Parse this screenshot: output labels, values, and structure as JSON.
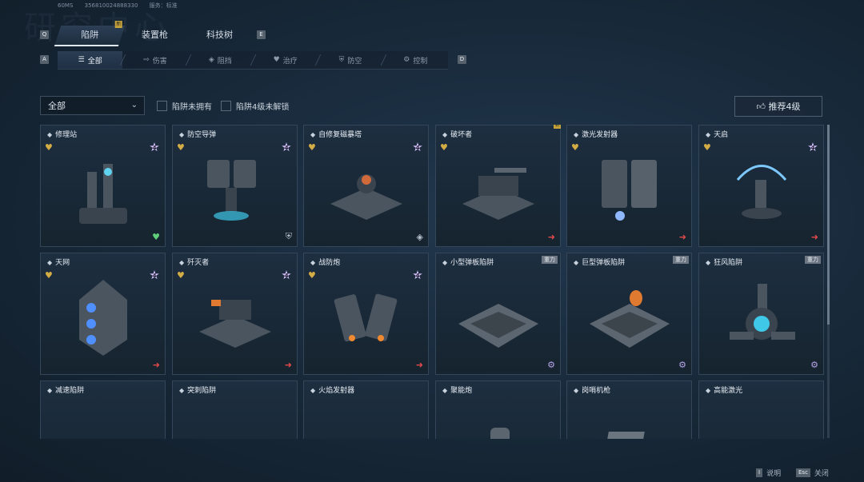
{
  "header": {
    "decor_title": "研究中心",
    "ping": "60MS",
    "uid": "356810024888330",
    "server_label": "服务：标准"
  },
  "keys": {
    "prev_tab": "Q",
    "next_tab": "E",
    "prev_filter": "A",
    "next_filter": "D"
  },
  "tabs": [
    {
      "label": "陷阱",
      "active": true,
      "badge": "新"
    },
    {
      "label": "装置枪",
      "active": false
    },
    {
      "label": "科技树",
      "active": false
    }
  ],
  "filters": [
    {
      "icon": "list-icon",
      "glyph": "☰",
      "label": "全部",
      "active": true
    },
    {
      "icon": "damage-icon",
      "glyph": "⇨",
      "label": "伤害"
    },
    {
      "icon": "block-icon",
      "glyph": "◈",
      "label": "阻挡"
    },
    {
      "icon": "heal-icon",
      "glyph": "♥",
      "label": "治疗"
    },
    {
      "icon": "anti-air-icon",
      "glyph": "⛨",
      "label": "防空"
    },
    {
      "icon": "control-icon",
      "glyph": "⚙",
      "label": "控制"
    }
  ],
  "toolbar": {
    "select_value": "全部",
    "check_not_owned": "陷阱未拥有",
    "check_lv4_locked": "陷阱4级未解锁",
    "recommend": "推荐4级"
  },
  "cards": [
    {
      "name": "修理站",
      "heart": true,
      "level": "4",
      "category": "heal",
      "cat_glyph": "♥"
    },
    {
      "name": "防空导弹",
      "heart": true,
      "level": "4",
      "category": "shield",
      "cat_glyph": "⛨"
    },
    {
      "name": "自修复磁暴塔",
      "heart": true,
      "level": "4",
      "category": "shield",
      "cat_glyph": "◈"
    },
    {
      "name": "破坏者",
      "heart": true,
      "new": "新",
      "category": "arrow",
      "cat_glyph": "➜"
    },
    {
      "name": "激光发射器",
      "heart": true,
      "category": "arrow",
      "cat_glyph": "➜"
    },
    {
      "name": "天启",
      "heart": true,
      "level": "4",
      "category": "arrow",
      "cat_glyph": "➜"
    },
    {
      "name": "天网",
      "heart": true,
      "level": "4",
      "category": "arrow",
      "cat_glyph": "➜"
    },
    {
      "name": "歼灭者",
      "heart": true,
      "level": "4",
      "category": "arrow",
      "cat_glyph": "➜"
    },
    {
      "name": "战防炮",
      "heart": true,
      "level": "4",
      "category": "arrow",
      "cat_glyph": "➜"
    },
    {
      "name": "小型弹板陷阱",
      "tag": "重力",
      "category": "ctrl",
      "cat_glyph": "⚙"
    },
    {
      "name": "巨型弹板陷阱",
      "tag": "重力",
      "category": "ctrl",
      "cat_glyph": "⚙"
    },
    {
      "name": "狂风陷阱",
      "tag": "重力",
      "category": "ctrl",
      "cat_glyph": "⚙"
    },
    {
      "name": "减速陷阱"
    },
    {
      "name": "突刺陷阱"
    },
    {
      "name": "火焰发射器"
    },
    {
      "name": "聚能炮"
    },
    {
      "name": "岗哨机枪"
    },
    {
      "name": "高能激光"
    }
  ],
  "footer": {
    "help_key": "I",
    "help_label": "说明",
    "close_key": "Esc",
    "close_label": "关闭"
  }
}
